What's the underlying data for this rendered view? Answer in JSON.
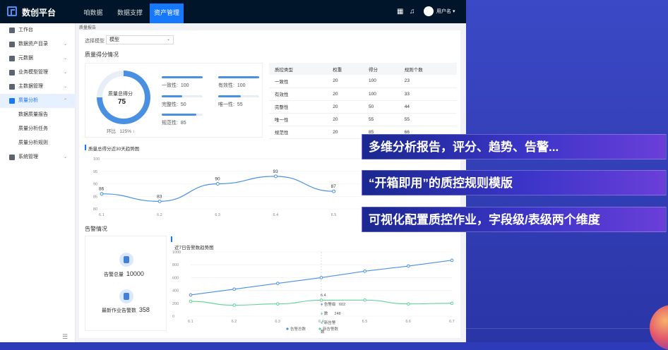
{
  "app": {
    "title": "数创平台"
  },
  "topnav": [
    {
      "label": "咱数据",
      "active": false
    },
    {
      "label": "数据支撑",
      "active": false
    },
    {
      "label": "资产管理",
      "active": true
    }
  ],
  "user": {
    "name": "用户名"
  },
  "sidebar": {
    "items": [
      {
        "label": "工作台",
        "icon": "dashboard-icon",
        "arrow": ""
      },
      {
        "label": "数据资产目录",
        "icon": "catalog-icon",
        "arrow": "⌄"
      },
      {
        "label": "元数据",
        "icon": "metadata-icon",
        "arrow": "⌄"
      },
      {
        "label": "业务模型管理",
        "icon": "model-icon",
        "arrow": "⌄"
      },
      {
        "label": "主数据管理",
        "icon": "master-data-icon",
        "arrow": "⌄"
      },
      {
        "label": "质量分析",
        "icon": "shield-icon",
        "arrow": "⌃"
      },
      {
        "label": "数据质量报告",
        "icon": "",
        "arrow": ""
      },
      {
        "label": "质量分析任务",
        "icon": "",
        "arrow": ""
      },
      {
        "label": "质量分析规则",
        "icon": "",
        "arrow": ""
      },
      {
        "label": "系统管理",
        "icon": "system-icon",
        "arrow": "⌄"
      }
    ]
  },
  "breadcrumb": "质量报告",
  "filter": {
    "label": "选择模型",
    "value": "模型"
  },
  "score_section": {
    "title": "质量得分情况",
    "total_label": "质量总得分",
    "total_value": "75",
    "ratio_label": "环比",
    "ratio_value": "125%",
    "ratio_arrow": "↑",
    "ring_fraction": 0.75,
    "metrics": [
      {
        "name": "一致性",
        "sep": ":",
        "value": "100",
        "fill": 1.0
      },
      {
        "name": "有效性",
        "sep": ":",
        "value": "100",
        "fill": 1.0
      },
      {
        "name": "完整性",
        "sep": ":",
        "value": "50",
        "fill": 0.5
      },
      {
        "name": "唯一性",
        "sep": ":",
        "value": "55",
        "fill": 0.55
      },
      {
        "name": "规范性",
        "sep": ":",
        "value": "85",
        "fill": 0.85
      }
    ]
  },
  "table": {
    "headers": [
      "质控类型",
      "权重",
      "得分",
      "规则个数"
    ],
    "rows": [
      [
        "一致性",
        "20",
        "100",
        "23"
      ],
      [
        "有效性",
        "20",
        "100",
        "33"
      ],
      [
        "完整性",
        "20",
        "50",
        "44"
      ],
      [
        "唯一性",
        "20",
        "55",
        "55"
      ],
      [
        "规范性",
        "20",
        "85",
        "66"
      ]
    ]
  },
  "alerts": {
    "title": "告警情况",
    "total_label": "告警总量",
    "total_value": "10000",
    "latest_label": "最新作业告警数",
    "latest_value": "358",
    "tooltip": {
      "date": "6.4",
      "row1_label": "告警级",
      "row1_value": "602",
      "row2_label": "数",
      "row2_value": "248",
      "row3_label": "新告警",
      "row4_label": "数"
    }
  },
  "banners": [
    "多维分析报告，评分、趋势、告警...",
    "“开箱即用”的质控规则模版",
    "可视化配置质控作业，字段级/表级两个维度"
  ],
  "colors": {
    "primary": "#4a90e2",
    "green": "#5fd29a",
    "nav_bg": "#001529",
    "active": "#1677ff"
  },
  "chart_data": [
    {
      "type": "line",
      "title": "质量总得分近30天趋势图",
      "x": [
        "6.1",
        "6.2",
        "6.3",
        "6.4",
        "6.5",
        "6.6",
        "6.7"
      ],
      "series": [
        {
          "values": [
            86,
            83,
            90,
            93,
            87,
            null,
            null
          ]
        }
      ],
      "data_labels": [
        "86",
        "83",
        "90",
        "93",
        "87"
      ],
      "ylim": [
        80,
        100
      ],
      "yticks": [
        "100",
        "95",
        "90",
        "85",
        "80"
      ]
    },
    {
      "type": "line",
      "title": "近7日告警数趋势图",
      "x": [
        "6.1",
        "6.2",
        "6.3",
        "6.4",
        "6.5",
        "6.6",
        "6.7"
      ],
      "series": [
        {
          "name": "告警总数",
          "values": [
            330,
            420,
            510,
            600,
            700,
            780,
            870
          ]
        },
        {
          "name": "新告警数",
          "values": [
            230,
            170,
            190,
            248,
            250,
            190,
            200
          ]
        }
      ],
      "ylim": [
        0,
        1000
      ],
      "yticks": [
        "1000",
        "800",
        "600",
        "400",
        "200",
        "0"
      ],
      "legend": "bottom"
    }
  ]
}
